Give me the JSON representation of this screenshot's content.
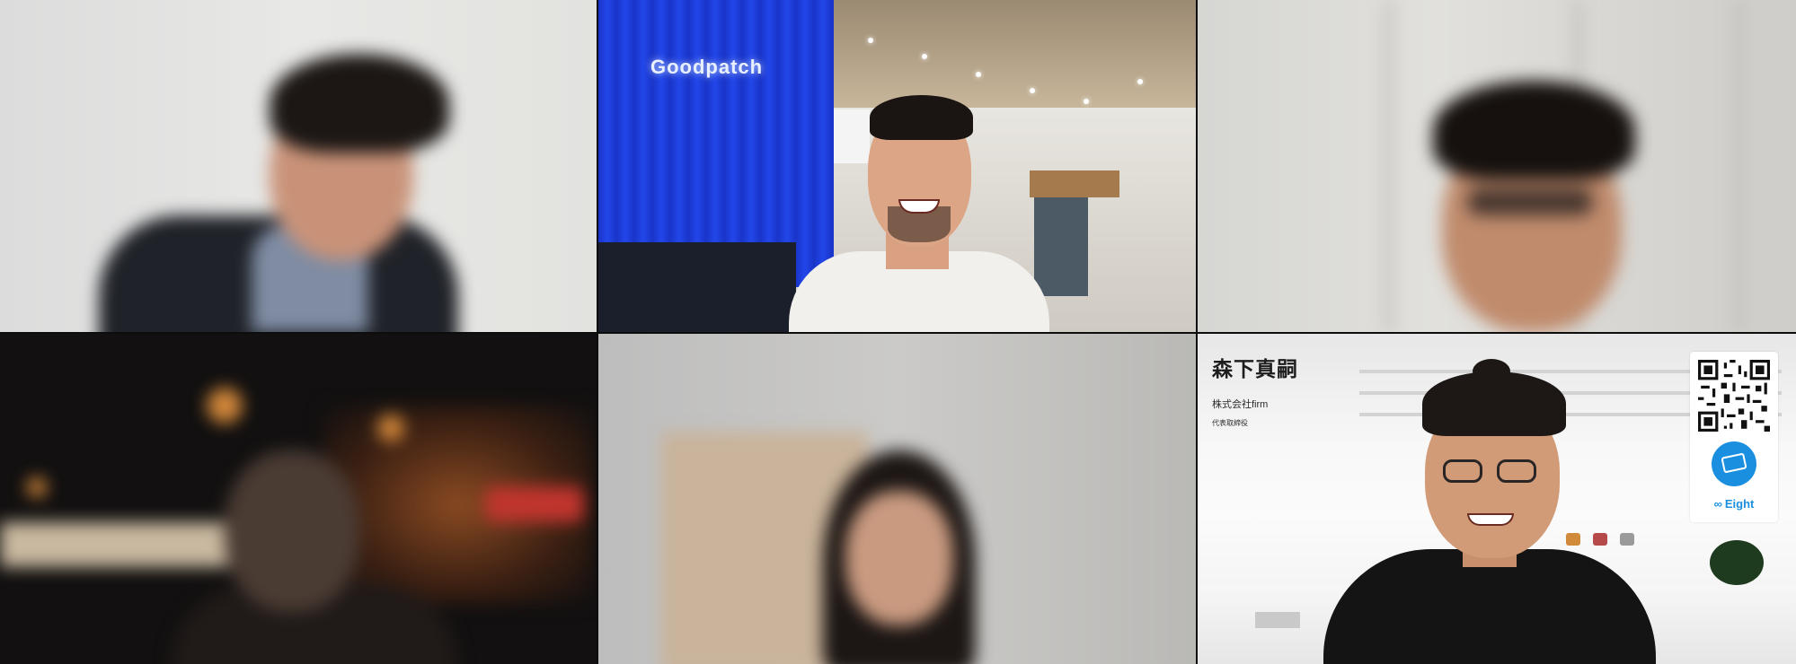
{
  "window": {
    "title": ""
  },
  "participants": [
    {
      "id": "p1",
      "video": "blurred man in suit, white wall"
    },
    {
      "id": "p2",
      "video": "smiling man in office with blue wall"
    },
    {
      "id": "p3",
      "video": "blurred man with glasses"
    },
    {
      "id": "p4",
      "video": "blurred man in dark restaurant"
    },
    {
      "id": "p5",
      "video": "blurred woman, grey wall"
    },
    {
      "id": "p6",
      "video": "man with glasses, virtual background"
    }
  ],
  "virtual_background": {
    "name": "森下真嗣",
    "company": "株式会社firm",
    "position": "代表取締役",
    "badge_label": "Eight",
    "badge_icon": "infinity-icon",
    "accent_color": "#1a8fe0"
  },
  "office_sign": {
    "text": "Goodpatch"
  }
}
